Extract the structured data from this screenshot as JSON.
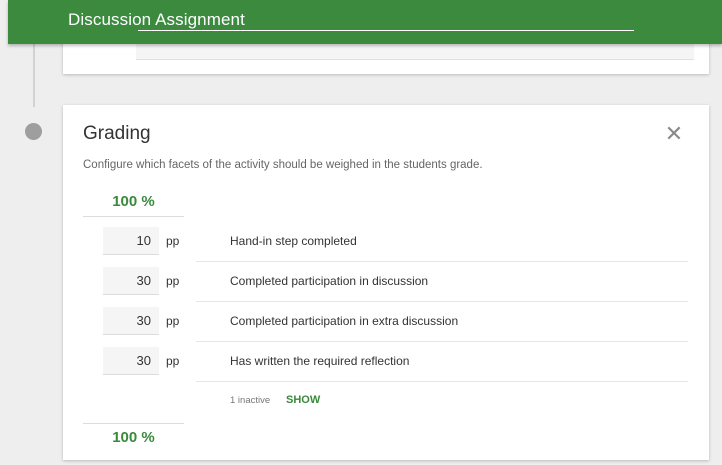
{
  "header": {
    "title": "Discussion Assignment"
  },
  "grading": {
    "title": "Grading",
    "description": "Configure which facets of the activity should be weighed in the students grade.",
    "total_top": "100 %",
    "total_bottom": "100 %",
    "rows": [
      {
        "value": "10",
        "unit": "pp",
        "label": "Hand-in step completed"
      },
      {
        "value": "30",
        "unit": "pp",
        "label": "Completed participation in discussion"
      },
      {
        "value": "30",
        "unit": "pp",
        "label": "Completed participation in extra discussion"
      },
      {
        "value": "30",
        "unit": "pp",
        "label": "Has written the required reflection"
      }
    ],
    "inactive_text": "1 inactive",
    "show_label": "SHOW",
    "close_glyph": "✕"
  },
  "colors": {
    "header_green": "#3b8a3e",
    "accent_green": "#3a8a3c",
    "background": "#eeeeee"
  },
  "icons": {
    "close": "close-icon"
  }
}
